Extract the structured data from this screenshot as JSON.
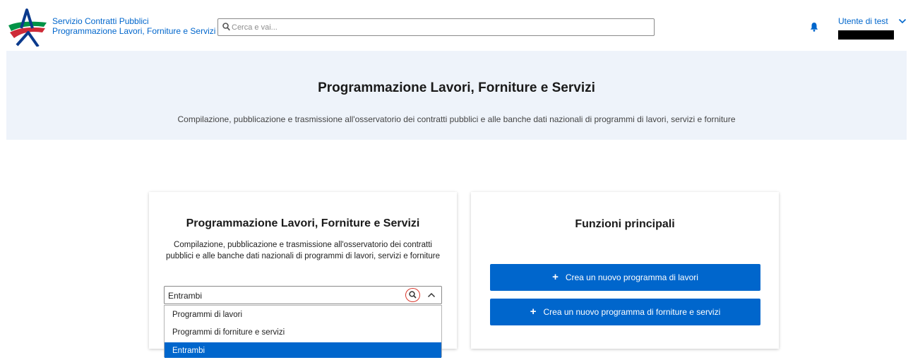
{
  "header": {
    "brand_line1": "Servizio Contratti Pubblici",
    "brand_line2": "Programmazione Lavori, Forniture e Servizi",
    "search_placeholder": "Cerca e vai...",
    "user_name": "Utente di test",
    "icons": {
      "search": "search-icon",
      "notifications": "bell-icon",
      "user_menu": "chevron-down-icon"
    }
  },
  "hero": {
    "title": "Programmazione Lavori, Forniture e Servizi",
    "subtitle": "Compilazione, pubblicazione e trasmissione all'osservatorio dei contratti pubblici e alle banche dati nazionali di programmi di lavori, servizi e forniture"
  },
  "left_card": {
    "title": "Programmazione Lavori, Forniture e Servizi",
    "description": "Compilazione, pubblicazione e trasmissione all'osservatorio dei contratti pubblici e alle banche dati nazionali di programmi di lavori, servizi e forniture",
    "select": {
      "value": "Entrambi",
      "options": [
        "Programmi di lavori",
        "Programmi di forniture e servizi",
        "Entrambi"
      ],
      "selected_index": 2
    }
  },
  "right_card": {
    "title": "Funzioni principali",
    "buttons": [
      {
        "label": "Crea un nuovo programma di lavori",
        "icon": "plus-icon"
      },
      {
        "label": "Crea un nuovo programma di forniture e servizi",
        "icon": "plus-icon"
      }
    ]
  },
  "colors": {
    "accent": "#0066cc",
    "hero_background": "#eef3fa",
    "search_highlight": "#d9362b",
    "logo_green": "#009246",
    "logo_red": "#ce2b37",
    "logo_blue": "#0b3a8c"
  }
}
